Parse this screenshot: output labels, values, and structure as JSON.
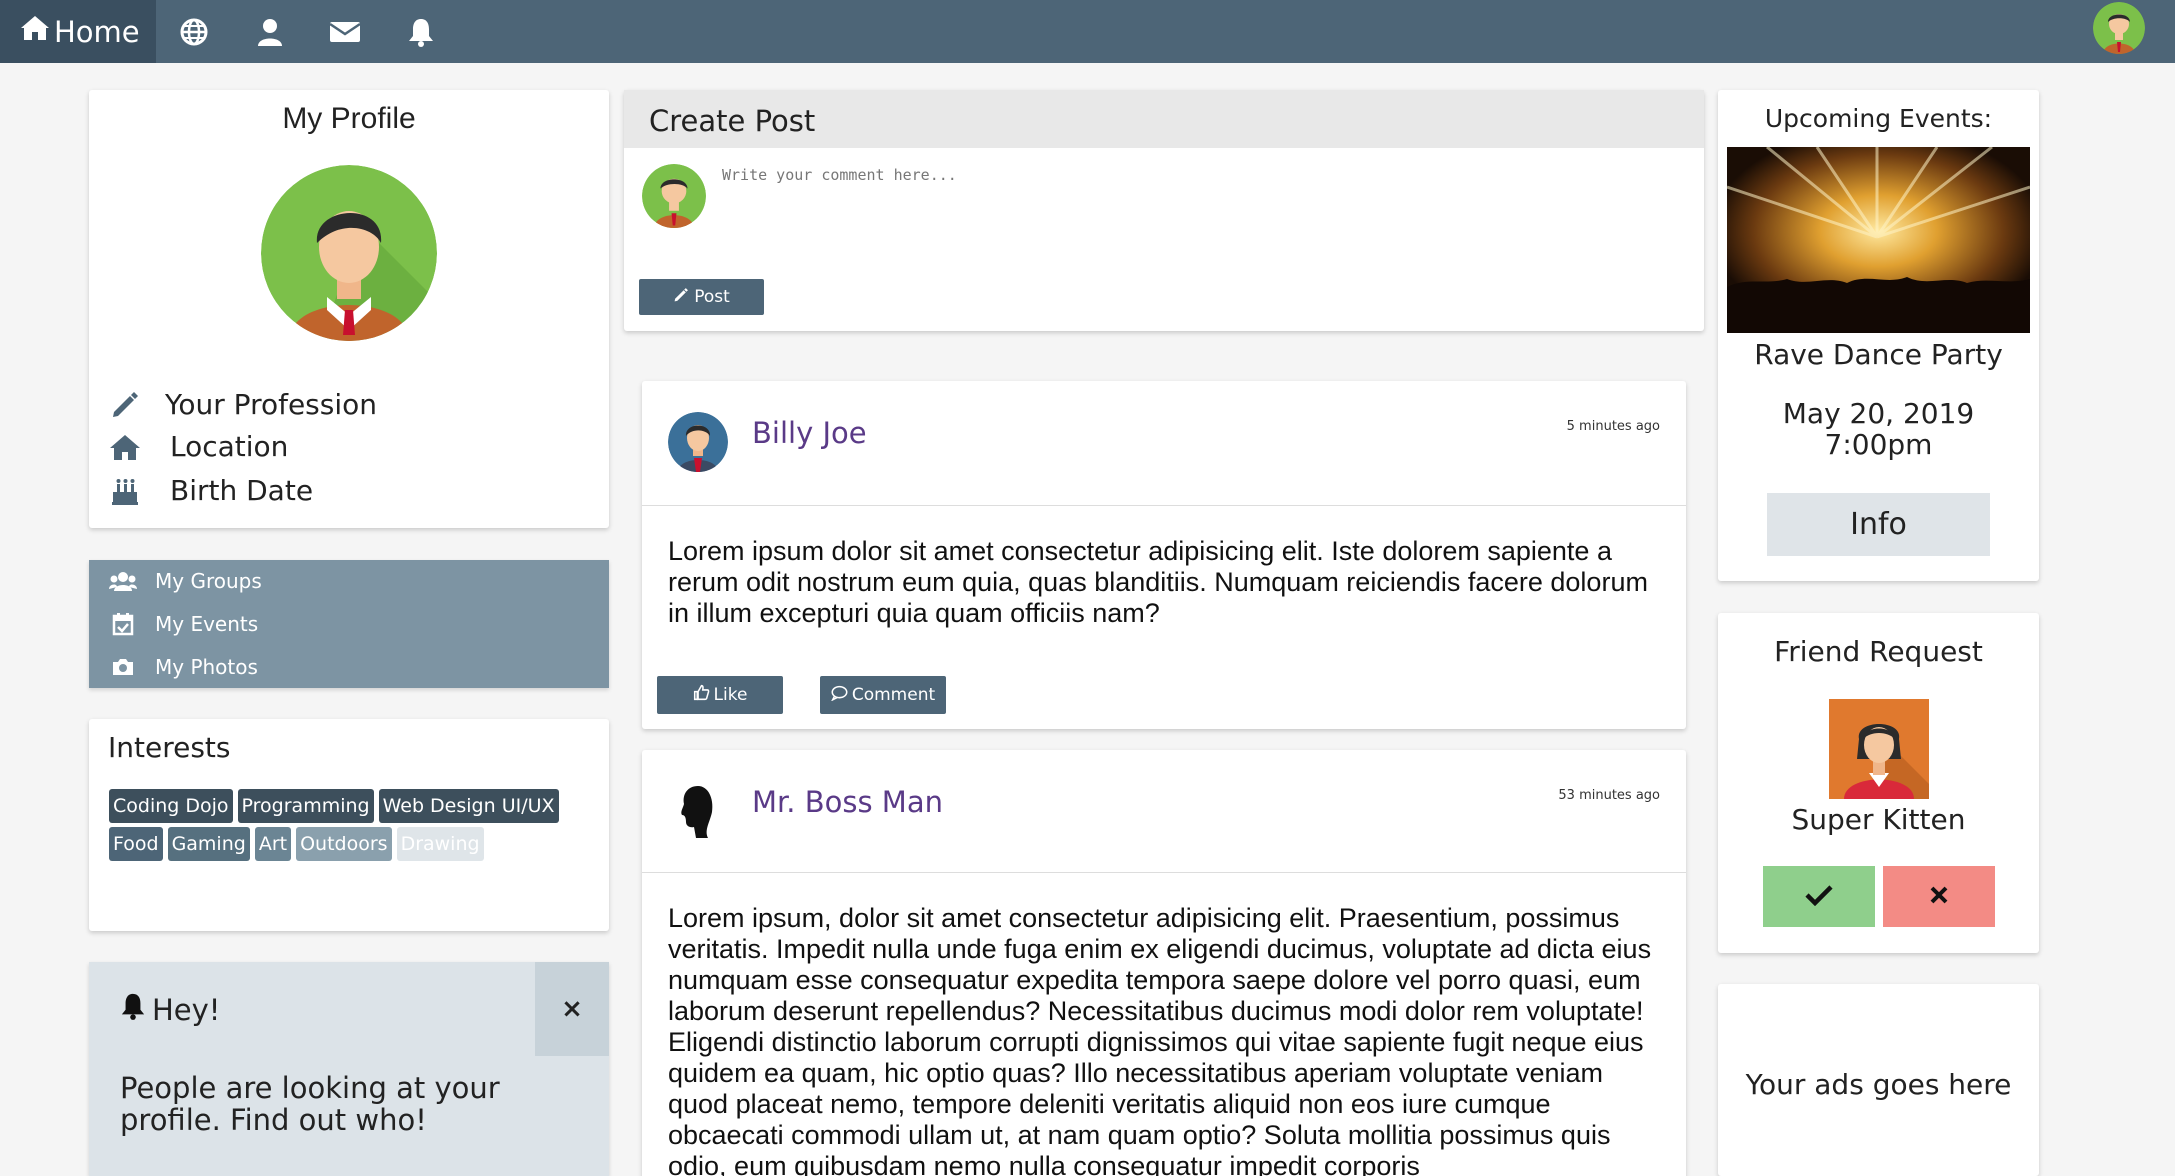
{
  "nav": {
    "home_label": "Home",
    "icons": [
      "home-icon",
      "globe-icon",
      "user-icon",
      "envelope-icon",
      "bell-icon"
    ]
  },
  "profile": {
    "title": "My Profile",
    "profession": "Your Profession",
    "location": "Location",
    "birth_date": "Birth Date"
  },
  "sidemenu": {
    "items": [
      {
        "label": "My Groups",
        "icon": "users-icon"
      },
      {
        "label": "My Events",
        "icon": "calendar-check-icon"
      },
      {
        "label": "My Photos",
        "icon": "camera-icon"
      }
    ]
  },
  "interests": {
    "title": "Interests",
    "row1": [
      {
        "label": "Coding Dojo",
        "color": "#3d4f5c"
      },
      {
        "label": "Programming",
        "color": "#3d4f5c"
      },
      {
        "label": "Web Design UI/UX",
        "color": "#3d4f5c"
      }
    ],
    "row2": [
      {
        "label": "Food",
        "color": "#4d6577"
      },
      {
        "label": "Gaming",
        "color": "#56707f"
      },
      {
        "label": "Art",
        "color": "#6b8594"
      },
      {
        "label": "Outdoors",
        "color": "#8aa0ad"
      },
      {
        "label": "Drawing",
        "color": "#d7dfe4"
      }
    ]
  },
  "alert": {
    "title": "Hey!",
    "close": "×",
    "body": "People are looking at your profile. Find out who!"
  },
  "create_post": {
    "title": "Create Post",
    "placeholder": "Write your comment here...",
    "button": "Post"
  },
  "posts": [
    {
      "author": "Billy Joe",
      "time": "5 minutes ago",
      "body": "Lorem ipsum dolor sit amet consectetur adipisicing elit. Iste dolorem sapiente a rerum odit nostrum eum quia, quas blanditiis. Numquam reiciendis facere dolorum in illum excepturi quia quam officiis nam?",
      "like": "Like",
      "comment": "Comment"
    },
    {
      "author": "Mr. Boss Man",
      "time": "53 minutes ago",
      "body": "Lorem ipsum, dolor sit amet consectetur adipisicing elit. Praesentium, possimus veritatis. Impedit nulla unde fuga enim ex eligendi ducimus, voluptate ad dicta eius numquam esse consequatur expedita tempora saepe dolore vel porro quasi, eum laborum deserunt repellendus? Necessitatibus ducimus modi dolor rem voluptate! Eligendi distinctio laborum corrupti dignissimos qui vitae sapiente fugit neque eius quidem ea quam, hic optio quas? Illo necessitatibus aperiam voluptate veniam quod placeat nemo, tempore deleniti veritatis aliquid non eos iure cumque obcaecati commodi ullam ut, at nam quam optio? Soluta mollitia possimus quis odio, eum quibusdam nemo nulla consequatur impedit corporis"
    }
  ],
  "events": {
    "title": "Upcoming Events:",
    "name": "Rave Dance Party",
    "date": "May 20, 2019",
    "time": "7:00pm",
    "button": "Info"
  },
  "friend_request": {
    "title": "Friend Request",
    "name": "Super Kitten"
  },
  "ads": {
    "text": "Your ads goes here"
  }
}
